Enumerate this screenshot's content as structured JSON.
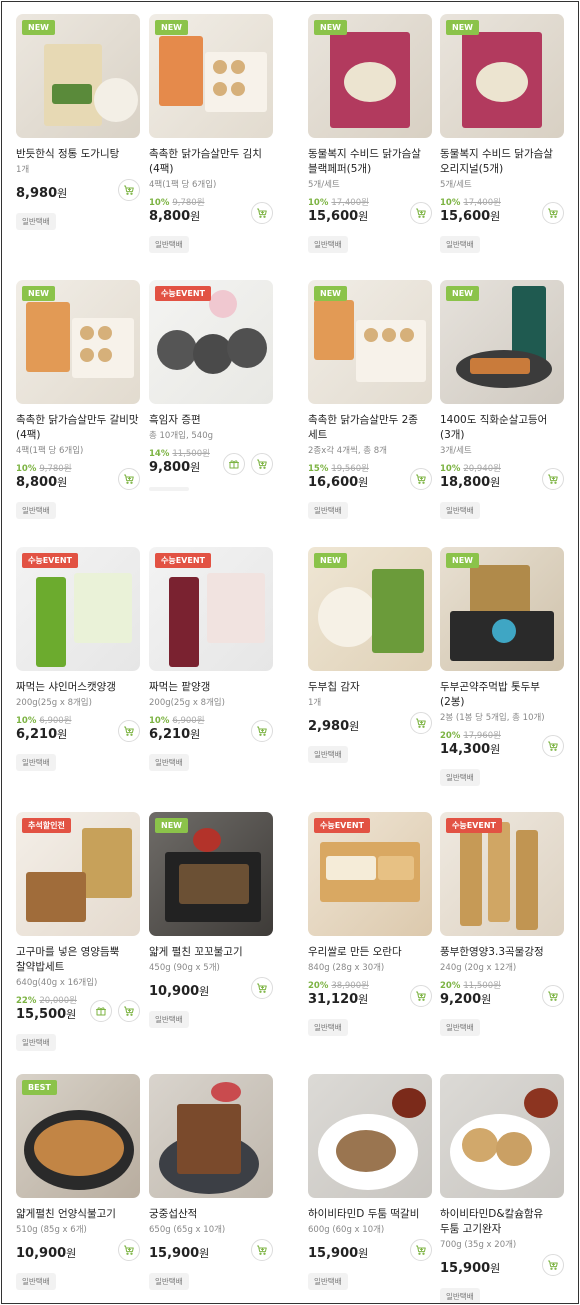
{
  "colors": {
    "accent_green": "#7cb342",
    "badge_green": "#8bc34a",
    "badge_red": "#e25243"
  },
  "icons": {
    "cart": "cart-icon",
    "gift": "gift-icon"
  },
  "products": [
    {
      "badge": "NEW",
      "name": "반듯한식 정통 도가니탕",
      "sub": "1개",
      "discount": "",
      "orig": "",
      "price": "8,980",
      "won": "원",
      "tag": "일반택배"
    },
    {
      "badge": "NEW",
      "name": "촉촉한 닭가슴살만두 김치 (4팩)",
      "sub": "4팩(1팩 당 6개입)",
      "discount": "10%",
      "orig": "9,780원",
      "price": "8,800",
      "won": "원",
      "tag": "일반택배"
    },
    {
      "badge": "NEW",
      "name": "동물복지 수비드 닭가슴살 블랙페퍼(5개)",
      "sub": "5개/세트",
      "discount": "10%",
      "orig": "17,400원",
      "price": "15,600",
      "won": "원",
      "tag": "일반택배"
    },
    {
      "badge": "NEW",
      "name": "동물복지 수비드 닭가슴살 오리지널(5개)",
      "sub": "5개/세트",
      "discount": "10%",
      "orig": "17,400원",
      "price": "15,600",
      "won": "원",
      "tag": "일반택배"
    },
    {
      "badge": "NEW",
      "name": "촉촉한 닭가슴살만두 갈비맛 (4팩)",
      "sub": "4팩(1팩 당 6개입)",
      "discount": "10%",
      "orig": "9,780원",
      "price": "8,800",
      "won": "원",
      "tag": "일반택배"
    },
    {
      "badge": "수능EVENT",
      "name": "흑임자 증편",
      "sub": "총 10개입, 540g",
      "discount": "14%",
      "orig": "11,500원",
      "price": "9,800",
      "won": "원",
      "tag": ""
    },
    {
      "badge": "NEW",
      "name": "촉촉한 닭가슴살만두 2종 세트",
      "sub": "2종x각 4개씩, 총 8개",
      "discount": "15%",
      "orig": "19,560원",
      "price": "16,600",
      "won": "원",
      "tag": "일반택배"
    },
    {
      "badge": "NEW",
      "name": "1400도 직화순살고등어 (3개)",
      "sub": "3개/세트",
      "discount": "10%",
      "orig": "20,940원",
      "price": "18,800",
      "won": "원",
      "tag": "일반택배"
    },
    {
      "badge": "수능EVENT",
      "name": "짜먹는 샤인머스캣양갱",
      "sub": "200g(25g x 8개입)",
      "discount": "10%",
      "orig": "6,900원",
      "price": "6,210",
      "won": "원",
      "tag": "일반택배"
    },
    {
      "badge": "수능EVENT",
      "name": "짜먹는 팥양갱",
      "sub": "200g(25g x 8개입)",
      "discount": "10%",
      "orig": "6,900원",
      "price": "6,210",
      "won": "원",
      "tag": "일반택배"
    },
    {
      "badge": "NEW",
      "name": "두부칩 감자",
      "sub": "1개",
      "discount": "",
      "orig": "",
      "price": "2,980",
      "won": "원",
      "tag": "일반택배"
    },
    {
      "badge": "NEW",
      "name": "두부곤약주먹밥 톳두부 (2봉)",
      "sub": "2봉 (1봉 당 5개입, 총 10개)",
      "discount": "20%",
      "orig": "17,960원",
      "price": "14,300",
      "won": "원",
      "tag": "일반택배"
    },
    {
      "badge": "추석할인전",
      "name": "고구마를 넣은 영양듬뿍 찰약밥세트",
      "sub": "640g(40g x 16개입)",
      "discount": "22%",
      "orig": "20,000원",
      "price": "15,500",
      "won": "원",
      "tag": "일반택배"
    },
    {
      "badge": "NEW",
      "name": "얇게 펼친 꼬꼬불고기",
      "sub": "450g (90g x 5개)",
      "discount": "",
      "orig": "",
      "price": "10,900",
      "won": "원",
      "tag": "일반택배"
    },
    {
      "badge": "수능EVENT",
      "name": "우리쌀로 만든 오란다",
      "sub": "840g (28g x 30개)",
      "discount": "20%",
      "orig": "38,900원",
      "price": "31,120",
      "won": "원",
      "tag": "일반택배"
    },
    {
      "badge": "수능EVENT",
      "name": "풍부한영양3.3곡물강정",
      "sub": "240g (20g x 12개)",
      "discount": "20%",
      "orig": "11,500원",
      "price": "9,200",
      "won": "원",
      "tag": "일반택배"
    },
    {
      "badge": "BEST",
      "name": "얇게펼친 언양식불고기",
      "sub": "510g (85g x 6개)",
      "discount": "",
      "orig": "",
      "price": "10,900",
      "won": "원",
      "tag": "일반택배"
    },
    {
      "badge": "",
      "name": "궁중섭산적",
      "sub": "650g (65g x 10개)",
      "discount": "",
      "orig": "",
      "price": "15,900",
      "won": "원",
      "tag": "일반택배"
    },
    {
      "badge": "",
      "name": "하이비타민D 두툼 떡갈비",
      "sub": "600g (60g x 10개)",
      "discount": "",
      "orig": "",
      "price": "15,900",
      "won": "원",
      "tag": "일반택배"
    },
    {
      "badge": "",
      "name": "하이비타민D&칼슘함유 두툼 고기완자",
      "sub": "700g (35g x 20개)",
      "discount": "",
      "orig": "",
      "price": "15,900",
      "won": "원",
      "tag": "일반택배"
    }
  ]
}
